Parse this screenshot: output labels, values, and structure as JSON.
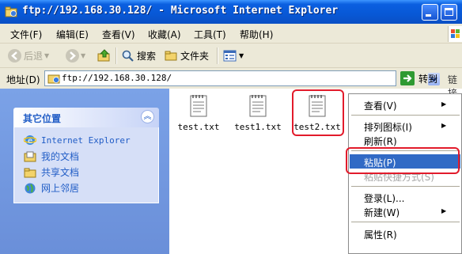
{
  "window": {
    "title": "ftp://192.168.30.128/ - Microsoft Internet Explorer"
  },
  "menubar": {
    "items": [
      "文件(F)",
      "编辑(E)",
      "查看(V)",
      "收藏(A)",
      "工具(T)",
      "帮助(H)"
    ]
  },
  "toolbar": {
    "back_label": "后退",
    "search_label": "搜索",
    "folders_label": "文件夹"
  },
  "address": {
    "label": "地址(D)",
    "value": "ftp://192.168.30.128/",
    "go_label": "转到",
    "links_label": "链接"
  },
  "sidebar": {
    "title": "其它位置",
    "items": [
      "Internet Explorer",
      "我的文档",
      "共享文档",
      "网上邻居"
    ]
  },
  "files": [
    "test.txt",
    "test1.txt",
    "test2.txt"
  ],
  "context_menu": {
    "items": [
      {
        "label": "查看(V)",
        "submenu": true
      },
      {
        "label": "排列图标(I)",
        "submenu": true
      },
      {
        "label": "刷新(R)"
      },
      {
        "label": "粘贴(P)",
        "highlighted": true
      },
      {
        "label": "粘贴快捷方式(S)",
        "disabled": true
      },
      {
        "label": "登录(L)..."
      },
      {
        "label": "新建(W)",
        "submenu": true
      },
      {
        "label": "属性(R)"
      }
    ]
  },
  "colors": {
    "titlebar": "#0858d6",
    "highlight": "#e21b2b",
    "menu_selection": "#316ac5"
  }
}
